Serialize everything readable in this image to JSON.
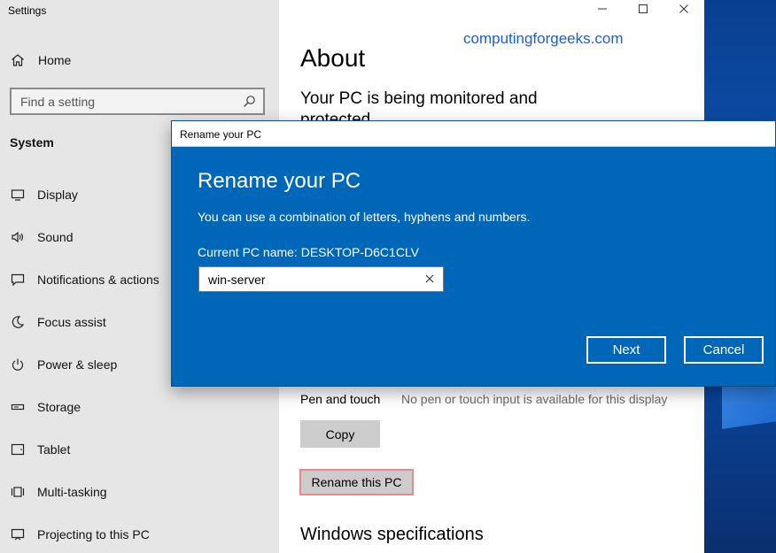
{
  "window": {
    "title": "Settings"
  },
  "watermark": "computingforgeeks.com",
  "sidebar": {
    "home_label": "Home",
    "search_placeholder": "Find a setting",
    "section_title": "System",
    "items": [
      {
        "label": "Display",
        "icon": "display-icon"
      },
      {
        "label": "Sound",
        "icon": "sound-icon"
      },
      {
        "label": "Notifications & actions",
        "icon": "notifications-icon"
      },
      {
        "label": "Focus assist",
        "icon": "focus-assist-icon"
      },
      {
        "label": "Power & sleep",
        "icon": "power-icon"
      },
      {
        "label": "Storage",
        "icon": "storage-icon"
      },
      {
        "label": "Tablet",
        "icon": "tablet-icon"
      },
      {
        "label": "Multi-tasking",
        "icon": "multitasking-icon"
      },
      {
        "label": "Projecting to this PC",
        "icon": "projecting-icon"
      }
    ]
  },
  "main": {
    "title": "About",
    "monitored_text": "Your PC is being monitored and protected.",
    "pen_label": "Pen and touch",
    "pen_value": "No pen or touch input is available for this display",
    "copy_label": "Copy",
    "rename_label": "Rename this PC",
    "windows_specs_heading": "Windows specifications"
  },
  "dialog": {
    "title": "Rename your PC",
    "heading": "Rename your PC",
    "description": "You can use a combination of letters, hyphens and numbers.",
    "current_name": "Current PC name: DESKTOP-D6C1CLV",
    "input_value": "win-server",
    "next_label": "Next",
    "cancel_label": "Cancel"
  },
  "colors": {
    "accent": "#0067b8",
    "sidebar_bg": "#e6e6e6",
    "watermark": "#1e5dd6",
    "rename_highlight": "#e8898f"
  }
}
